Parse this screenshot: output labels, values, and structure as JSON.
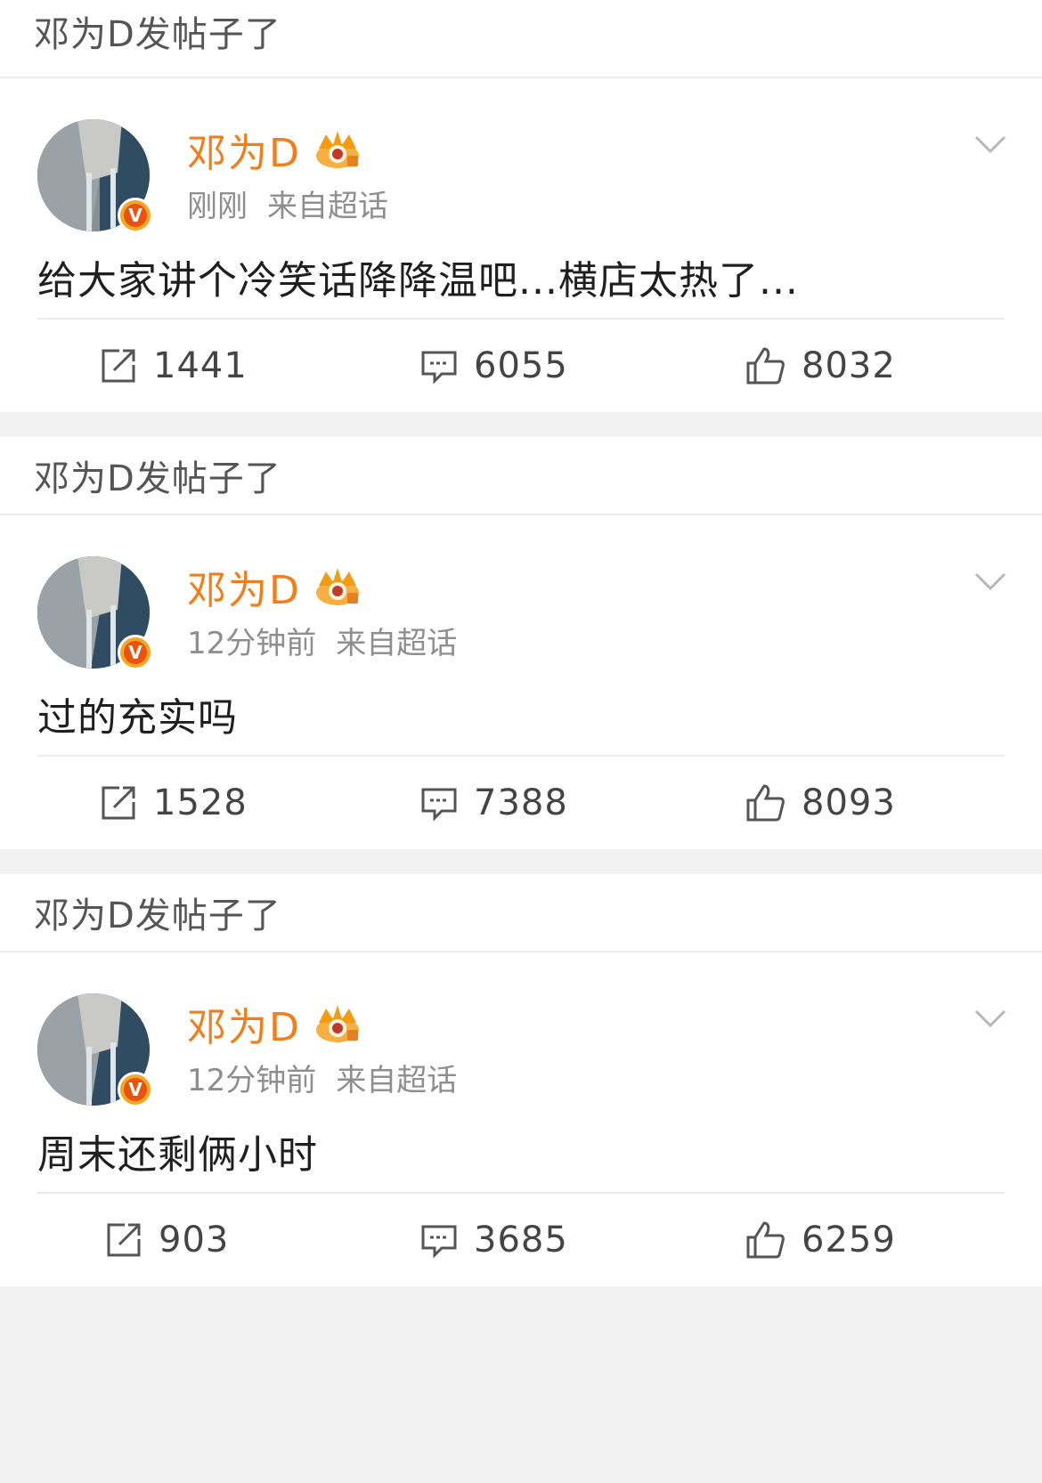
{
  "colors": {
    "author_name": "#f07e1b",
    "meta": "#8e8e8e",
    "background_gap": "#f2f2f2",
    "verified_badge": "#e8530e"
  },
  "icons": {
    "repost": "repost-icon",
    "comment": "comment-icon",
    "like": "thumbs-up-icon",
    "more": "chevron-down-icon",
    "crown": "crown-badge-icon",
    "verified": "verified-v-icon"
  },
  "posts": [
    {
      "header": "邓为D发帖子了",
      "author": "邓为D",
      "time": "刚刚",
      "source": "来自超话",
      "verified_mark": "V",
      "text": "给大家讲个冷笑话降降温吧...横店太热了...",
      "reposts": "1441",
      "comments": "6055",
      "likes": "8032"
    },
    {
      "header": "邓为D发帖子了",
      "author": "邓为D",
      "time": "12分钟前",
      "source": "来自超话",
      "verified_mark": "V",
      "text": "过的充实吗",
      "reposts": "1528",
      "comments": "7388",
      "likes": "8093"
    },
    {
      "header": "邓为D发帖子了",
      "author": "邓为D",
      "time": "12分钟前",
      "source": "来自超话",
      "verified_mark": "V",
      "text": "周末还剩俩小时",
      "reposts": "903",
      "comments": "3685",
      "likes": "6259"
    }
  ]
}
